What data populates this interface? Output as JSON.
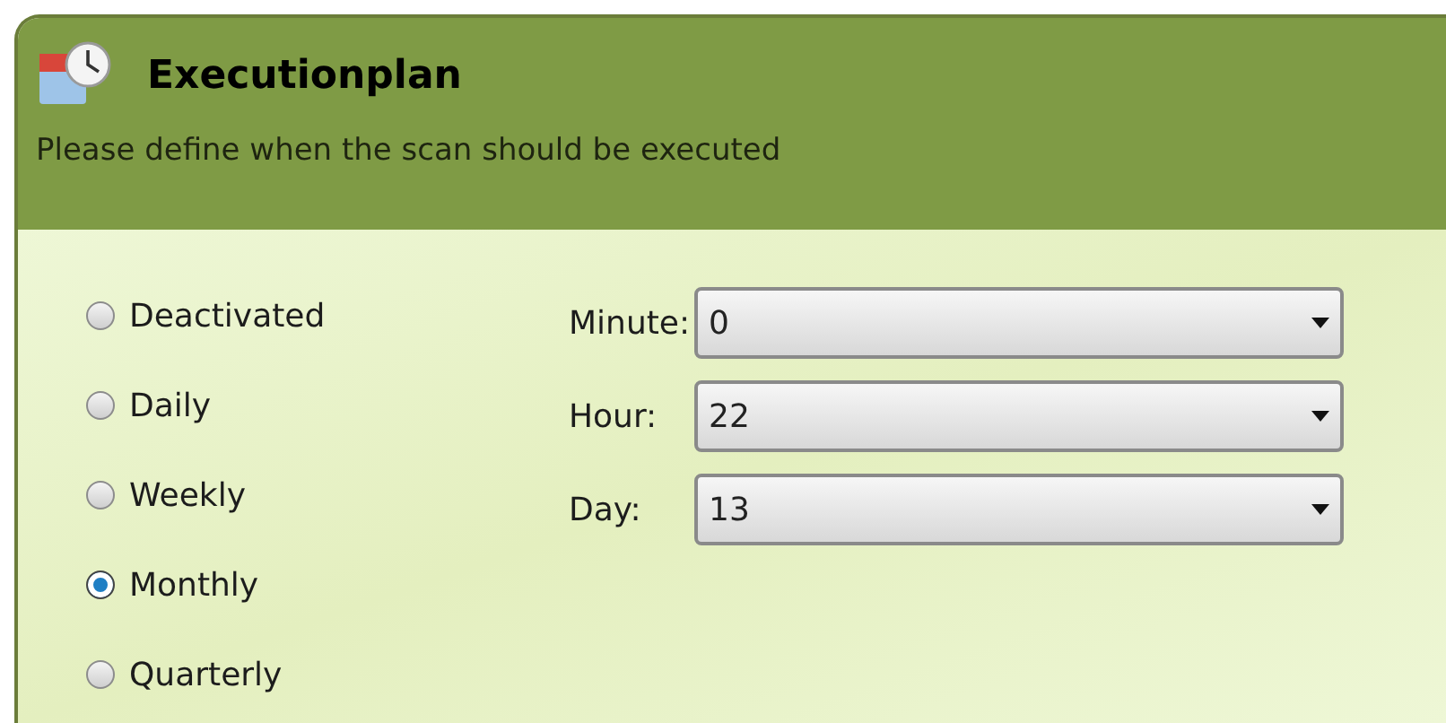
{
  "header": {
    "title": "Executionplan",
    "subtitle": "Please define when the scan should be executed"
  },
  "schedule": [
    {
      "label": "Deactivated",
      "selected": false
    },
    {
      "label": "Daily",
      "selected": false
    },
    {
      "label": "Weekly",
      "selected": false
    },
    {
      "label": "Monthly",
      "selected": true
    },
    {
      "label": "Quarterly",
      "selected": false
    }
  ],
  "fields": [
    {
      "label": "Minute:",
      "value": "0"
    },
    {
      "label": "Hour:",
      "value": "22"
    },
    {
      "label": "Day:",
      "value": "13"
    }
  ]
}
